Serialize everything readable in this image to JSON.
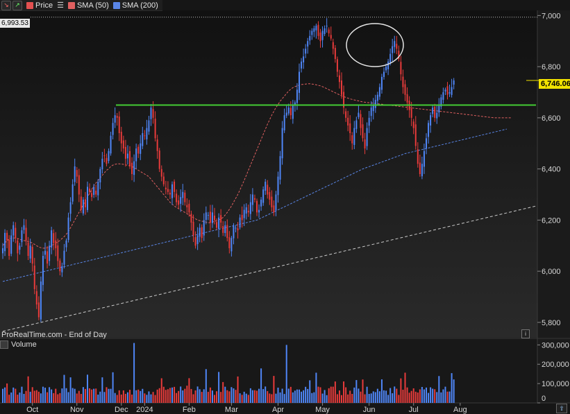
{
  "toolbar": {
    "price_label": "Price",
    "sma50_label": "SMA (50)",
    "sma200_label": "SMA (200)",
    "price_color": "#e25050",
    "sma50_color": "#e06060",
    "sma200_color": "#5a86e8",
    "icons": [
      "price-down-icon",
      "price-up-icon",
      "list-icon"
    ]
  },
  "ref_price_label": "6,993.53",
  "last_price_label": "6,746.06",
  "watermark": "ProRealTime.com - End of Day",
  "volume_title": "Volume",
  "colors": {
    "background": "#161616",
    "up_candle": "#4f86f7",
    "down_candle": "#e83b3b",
    "sma50": "#e06060",
    "sma200": "#5a86e8",
    "support_line": "#44cc33",
    "trendline": "#cccccc",
    "last_price_badge": "#f2e200"
  },
  "chart_data": {
    "type": "candlestick",
    "instrument": "",
    "y_ticks": [
      "5,800",
      "6,000",
      "6,200",
      "6,400",
      "6,600",
      "6,800",
      "7,000"
    ],
    "y_tick_values": [
      5800,
      6000,
      6200,
      6400,
      6600,
      6800,
      7000
    ],
    "ylim": [
      5740,
      7020
    ],
    "x_ticks": [
      "Oct",
      "Nov",
      "Dec",
      "2024",
      "Feb",
      "Mar",
      "Apr",
      "May",
      "Jun",
      "Jul",
      "Aug"
    ],
    "x_tick_bars": [
      14,
      35,
      56,
      67,
      88,
      108,
      130,
      151,
      173,
      194,
      216
    ],
    "reference_line": 6993.53,
    "last_price": 6746.06,
    "support_level": 6650,
    "trendline": {
      "start_bar": 0,
      "start_value": 5765,
      "end_bar": 246,
      "end_value": 6255
    },
    "closes": [
      6090,
      6150,
      6120,
      6060,
      6140,
      6180,
      6130,
      6070,
      6100,
      6160,
      6180,
      6120,
      6060,
      6100,
      6030,
      5930,
      5870,
      5820,
      5960,
      6060,
      6080,
      6030,
      6100,
      6160,
      6110,
      6090,
      6040,
      6000,
      6020,
      6080,
      6120,
      6210,
      6270,
      6340,
      6410,
      6370,
      6300,
      6240,
      6280,
      6250,
      6330,
      6310,
      6290,
      6330,
      6300,
      6350,
      6400,
      6440,
      6450,
      6420,
      6470,
      6530,
      6580,
      6610,
      6600,
      6540,
      6500,
      6480,
      6440,
      6460,
      6410,
      6380,
      6430,
      6480,
      6460,
      6500,
      6540,
      6530,
      6560,
      6590,
      6640,
      6600,
      6520,
      6470,
      6400,
      6370,
      6340,
      6320,
      6310,
      6300,
      6340,
      6310,
      6270,
      6260,
      6290,
      6310,
      6270,
      6250,
      6230,
      6190,
      6140,
      6100,
      6140,
      6170,
      6130,
      6200,
      6230,
      6220,
      6190,
      6230,
      6200,
      6170,
      6210,
      6190,
      6150,
      6180,
      6130,
      6090,
      6130,
      6180,
      6170,
      6160,
      6210,
      6200,
      6240,
      6250,
      6230,
      6270,
      6300,
      6280,
      6230,
      6240,
      6280,
      6320,
      6350,
      6300,
      6280,
      6250,
      6230,
      6300,
      6370,
      6450,
      6560,
      6610,
      6620,
      6640,
      6610,
      6650,
      6660,
      6710,
      6780,
      6820,
      6840,
      6870,
      6900,
      6920,
      6940,
      6950,
      6960,
      6920,
      6900,
      6940,
      6950,
      6960,
      6930,
      6910,
      6870,
      6830,
      6780,
      6740,
      6690,
      6640,
      6600,
      6570,
      6540,
      6500,
      6560,
      6590,
      6620,
      6560,
      6520,
      6480,
      6560,
      6600,
      6640,
      6650,
      6670,
      6690,
      6720,
      6760,
      6780,
      6800,
      6820,
      6850,
      6880,
      6900,
      6870,
      6830,
      6770,
      6720,
      6690,
      6660,
      6630,
      6600,
      6560,
      6490,
      6420,
      6380,
      6420,
      6470,
      6520,
      6580,
      6610,
      6640,
      6600,
      6620,
      6650,
      6680,
      6700,
      6710,
      6690,
      6700,
      6720,
      6746
    ],
    "sma50": [
      6100,
      6110,
      6120,
      6125,
      6130,
      6130,
      6130,
      6128,
      6125,
      6122,
      6120,
      6118,
      6116,
      6114,
      6110,
      6105,
      6100,
      6095,
      6092,
      6090,
      6090,
      6092,
      6095,
      6100,
      6105,
      6110,
      6115,
      6120,
      6128,
      6135,
      6145,
      6155,
      6170,
      6185,
      6200,
      6215,
      6230,
      6245,
      6260,
      6275,
      6290,
      6305,
      6320,
      6335,
      6345,
      6355,
      6365,
      6375,
      6385,
      6395,
      6400,
      6410,
      6415,
      6418,
      6420,
      6420,
      6419,
      6418,
      6416,
      6414,
      6412,
      6410,
      6405,
      6400,
      6395,
      6390,
      6385,
      6380,
      6375,
      6370,
      6360,
      6350,
      6340,
      6330,
      6320,
      6310,
      6300,
      6290,
      6280,
      6270,
      6262,
      6255,
      6250,
      6245,
      6240,
      6235,
      6230,
      6225,
      6220,
      6215,
      6210,
      6205,
      6200,
      6198,
      6196,
      6194,
      6192,
      6190,
      6190,
      6192,
      6195,
      6198,
      6200,
      6205,
      6210,
      6220,
      6230,
      6242,
      6255,
      6270,
      6285,
      6300,
      6318,
      6336,
      6355,
      6375,
      6395,
      6415,
      6435,
      6455,
      6475,
      6495,
      6515,
      6535,
      6555,
      6575,
      6592,
      6610,
      6625,
      6640,
      6652,
      6665,
      6675,
      6685,
      6695,
      6705,
      6712,
      6718,
      6722,
      6725,
      6728,
      6730,
      6731,
      6732,
      6733,
      6733,
      6732,
      6731,
      6729,
      6727,
      6725,
      6722,
      6718,
      6714,
      6710,
      6706,
      6702,
      6698,
      6694,
      6690,
      6686,
      6683,
      6680,
      6677,
      6674,
      6672,
      6670,
      6668,
      6666,
      6664,
      6662,
      6661,
      6660,
      6659,
      6658,
      6657,
      6656,
      6655,
      6654,
      6653,
      6652,
      6651,
      6650,
      6649,
      6648,
      6647,
      6646,
      6645,
      6644,
      6643,
      6642,
      6641,
      6640,
      6639,
      6638,
      6637,
      6636,
      6635,
      6634,
      6633,
      6632,
      6631,
      6630,
      6629,
      6628,
      6627,
      6626,
      6625,
      6624,
      6623,
      6622,
      6621,
      6620,
      6619,
      6618,
      6617,
      6616,
      6615,
      6614,
      6613,
      6612,
      6611,
      6610,
      6609,
      6608,
      6607,
      6606,
      6605,
      6604,
      6603,
      6602,
      6601,
      6600,
      6600,
      6600,
      6600,
      6600,
      6600,
      6600,
      6600,
      6600
    ],
    "sma200": [
      5960,
      5962,
      5964,
      5966,
      5968,
      5970,
      5972,
      5974,
      5976,
      5978,
      5980,
      5982,
      5984,
      5986,
      5988,
      5990,
      5992,
      5994,
      5996,
      5998,
      6000,
      6002,
      6004,
      6006,
      6008,
      6010,
      6012,
      6014,
      6016,
      6018,
      6020,
      6022,
      6024,
      6026,
      6028,
      6030,
      6032,
      6034,
      6036,
      6038,
      6040,
      6042,
      6044,
      6046,
      6048,
      6050,
      6052,
      6054,
      6056,
      6058,
      6060,
      6062,
      6064,
      6066,
      6068,
      6070,
      6072,
      6074,
      6076,
      6078,
      6080,
      6082,
      6084,
      6086,
      6088,
      6090,
      6092,
      6094,
      6096,
      6098,
      6100,
      6102,
      6104,
      6106,
      6108,
      6110,
      6112,
      6114,
      6116,
      6118,
      6120,
      6122,
      6124,
      6126,
      6128,
      6130,
      6132,
      6134,
      6136,
      6138,
      6140,
      6142,
      6144,
      6146,
      6148,
      6150,
      6152,
      6154,
      6156,
      6158,
      6160,
      6162,
      6164,
      6166,
      6168,
      6170,
      6172,
      6174,
      6176,
      6178,
      6180,
      6182,
      6184,
      6186,
      6188,
      6190,
      6192,
      6194,
      6196,
      6198,
      6200,
      6204,
      6208,
      6212,
      6216,
      6220,
      6224,
      6228,
      6232,
      6236,
      6240,
      6244,
      6248,
      6252,
      6256,
      6260,
      6264,
      6268,
      6272,
      6276,
      6280,
      6284,
      6288,
      6292,
      6296,
      6300,
      6304,
      6308,
      6312,
      6316,
      6320,
      6324,
      6328,
      6332,
      6336,
      6340,
      6344,
      6348,
      6352,
      6356,
      6360,
      6364,
      6368,
      6372,
      6376,
      6380,
      6384,
      6388,
      6392,
      6396,
      6400,
      6403,
      6406,
      6409,
      6412,
      6415,
      6418,
      6421,
      6424,
      6427,
      6430,
      6433,
      6436,
      6439,
      6442,
      6445,
      6448,
      6451,
      6454,
      6457,
      6460,
      6462,
      6464,
      6466,
      6468,
      6470,
      6472,
      6474,
      6476,
      6478,
      6480,
      6482,
      6484,
      6486,
      6488,
      6490,
      6492,
      6494,
      6496,
      6498,
      6500,
      6502,
      6504,
      6506,
      6508,
      6510,
      6512,
      6514,
      6516,
      6518,
      6520,
      6522,
      6524,
      6526,
      6528,
      6530,
      6532,
      6534,
      6536,
      6538,
      6540,
      6542,
      6544,
      6546,
      6548,
      6550,
      6552,
      6554,
      6556
    ],
    "volume_ticks": [
      "300,000",
      "200,000",
      "100,000",
      "0"
    ],
    "volume_tick_values": [
      300000,
      200000,
      100000,
      0
    ],
    "volume_ylim": [
      0,
      330000
    ]
  }
}
